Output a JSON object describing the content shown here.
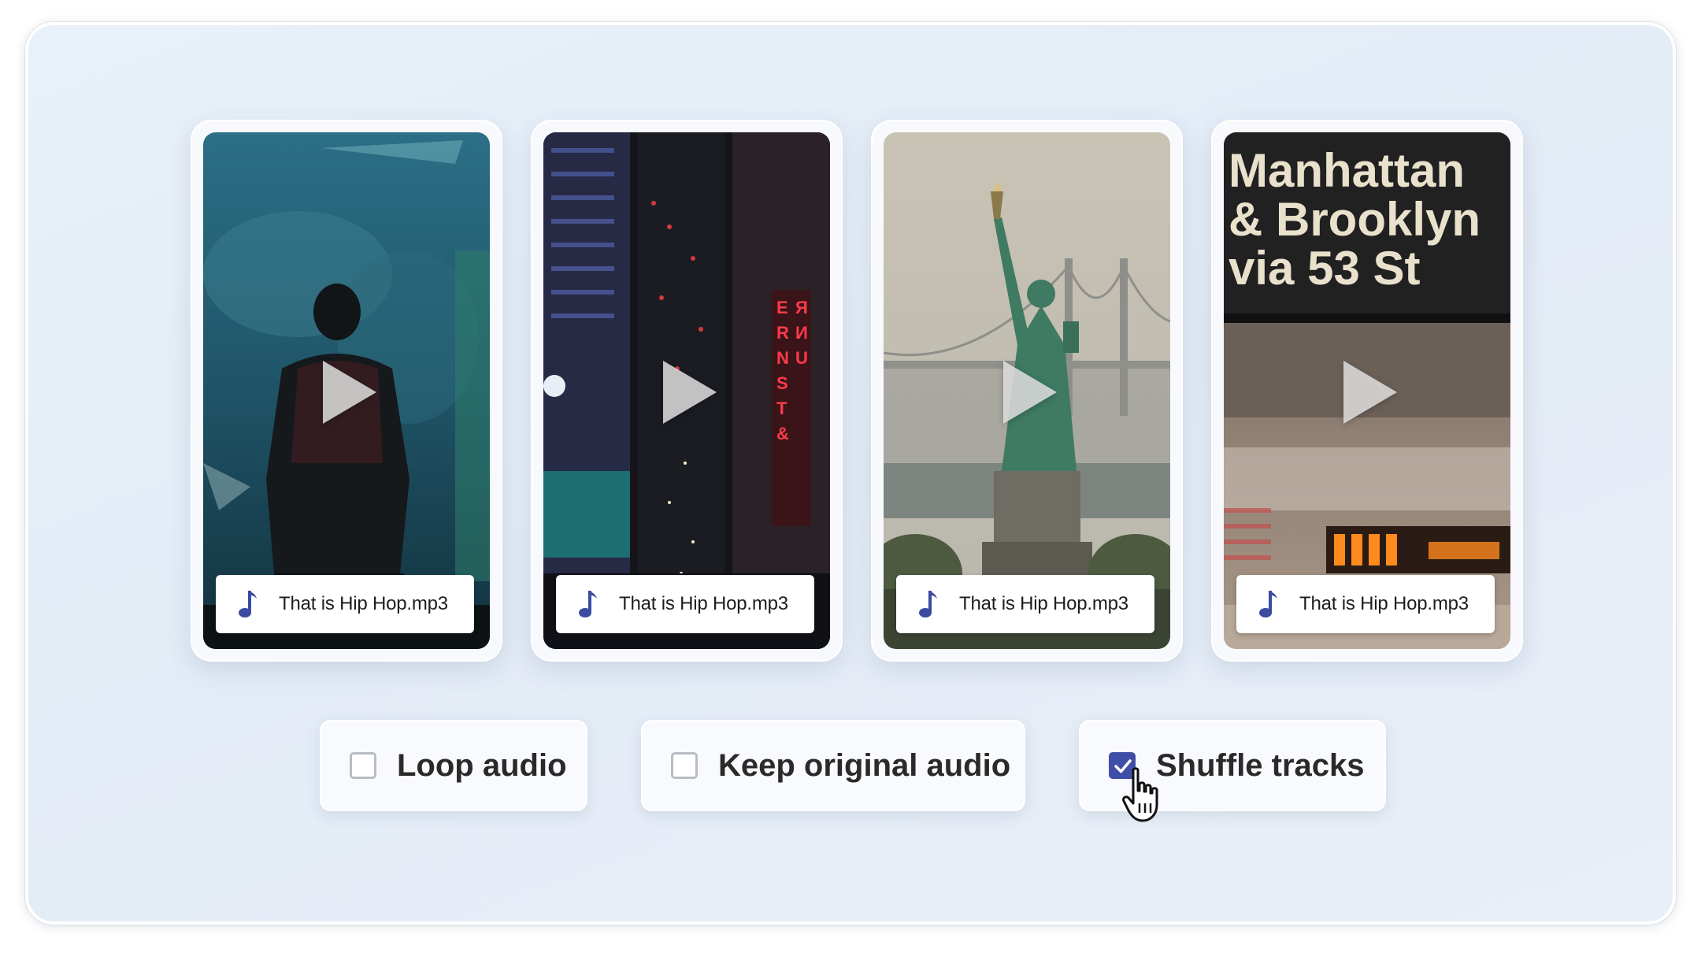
{
  "cards": [
    {
      "scene": "aquarium-silhouette",
      "audio_label": "That is Hip Hop.mp3",
      "icon": "music-note-icon"
    },
    {
      "scene": "night-city-aerial",
      "audio_label": "That is Hip Hop.mp3",
      "icon": "music-note-icon"
    },
    {
      "scene": "statue-of-liberty-bridge",
      "audio_label": "That is Hip Hop.mp3",
      "icon": "music-note-icon"
    },
    {
      "scene": "subway-sign",
      "audio_label": "That is Hip Hop.mp3",
      "icon": "music-note-icon",
      "sign_lines": [
        "Manhattan",
        "& Brooklyn",
        "via 53 St"
      ]
    }
  ],
  "options": [
    {
      "label": "Loop audio",
      "checked": false
    },
    {
      "label": "Keep original audio",
      "checked": false
    },
    {
      "label": "Shuffle tracks",
      "checked": true
    }
  ],
  "colors": {
    "accent": "#3f4fa8",
    "note_icon": "#3a4ba0",
    "background": "#e6eef8"
  }
}
